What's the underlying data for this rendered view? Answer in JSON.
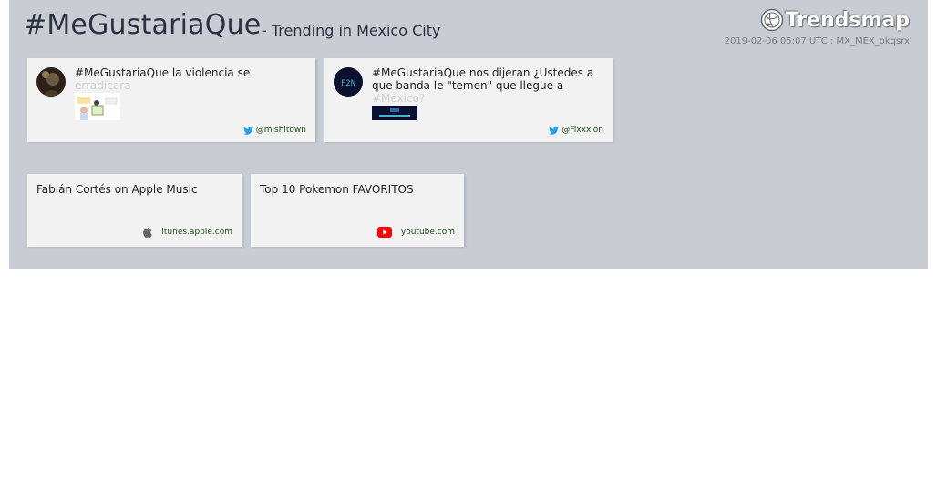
{
  "header": {
    "hashtag": "#MeGustariaQue",
    "subtitle": "- Trending in Mexico City",
    "logo_text": "Trendsmap",
    "meta": "2019-02-06 05:07 UTC : MX_MEX_okqsrx"
  },
  "tweets": [
    {
      "text": "#MeGustariaQue la violencia se",
      "text_fade": "erradicara",
      "handle": "@mishitown"
    },
    {
      "text": "#MeGustariaQue nos dijeran ¿Ustedes a que banda le \"temen\" que llegue a",
      "text_fade": "#México?",
      "handle": "@Fixxxion"
    }
  ],
  "links": [
    {
      "title": "Fabián Cortés on Apple Music",
      "source": "itunes.apple.com"
    },
    {
      "title": "Top 10 Pokemon FAVORITOS",
      "source": "youtube.com"
    }
  ],
  "colors": {
    "panel_bg": "#c9ccd3",
    "card_bg": "#f2f2f2",
    "twitter_blue": "#1da1f2",
    "youtube_red": "#ff0000",
    "link_green": "#1a4c1a"
  }
}
